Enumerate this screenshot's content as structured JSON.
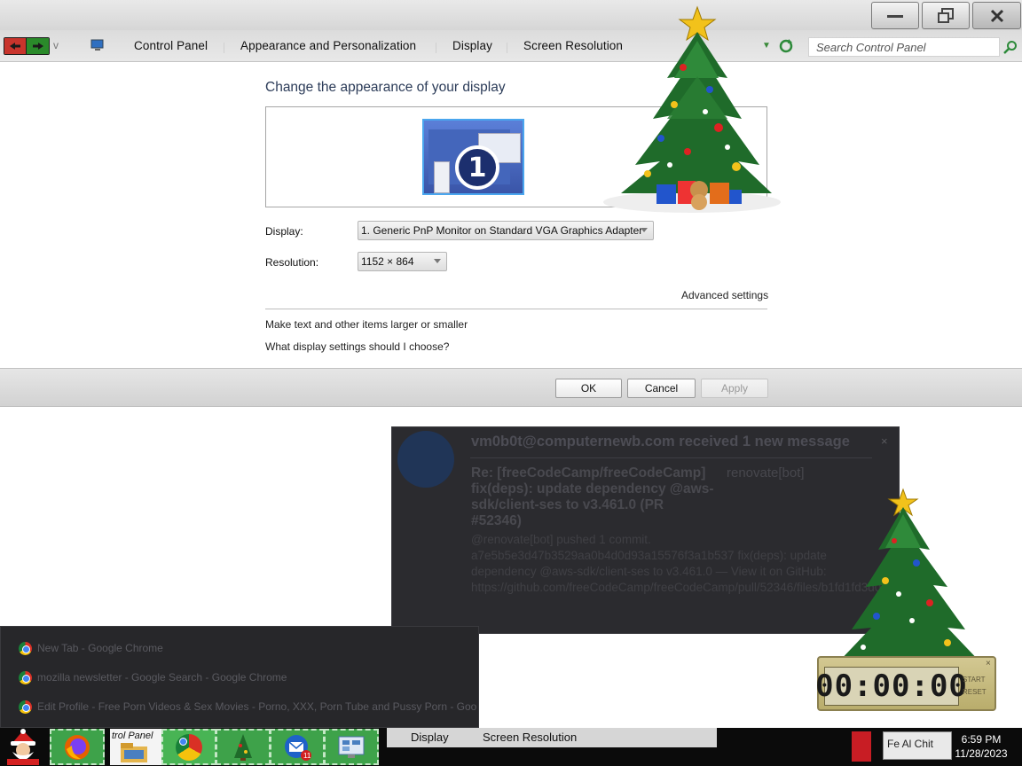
{
  "window": {
    "controls": {
      "minimize": "minimize",
      "maximize": "restore",
      "close": "close"
    }
  },
  "addressbar": {
    "breadcrumbs": [
      "Control Panel",
      "Appearance and Personalization",
      "Display",
      "Screen Resolution"
    ],
    "search_placeholder": "Search Control Panel"
  },
  "main": {
    "title": "Change the appearance of your display",
    "monitor_number": "1",
    "display_label": "Display:",
    "display_value": "1. Generic PnP Monitor on Standard VGA Graphics Adapter",
    "resolution_label": "Resolution:",
    "resolution_value": "1152 × 864",
    "advanced_link": "Advanced settings",
    "links": [
      "Make text and other items larger or smaller",
      "What display settings should I choose?"
    ]
  },
  "footer": {
    "ok": "OK",
    "cancel": "Cancel",
    "apply": "Apply"
  },
  "notification": {
    "title": "vm0b0t@computernewb.com received 1 new message",
    "close": "×",
    "subject": "Re: [freeCodeCamp/freeCodeCamp] fix(deps): update dependency @aws-sdk/client-ses to v3.461.0 (PR #52346)",
    "sender": "renovate[bot]",
    "body": "@renovate[bot] pushed 1 commit. a7e5b5e3d47b3529aa0b4d0d93a15576f3a1b537 fix(deps): update dependency @aws-sdk/client-ses to v3.461.0 — View it on GitHub: https://github.com/freeCodeCamp/freeCodeCamp/pull/52346/files/b1fd1fd3d0d8b87fe4e0454f78830"
  },
  "jumplist": {
    "items": [
      "New Tab - Google Chrome",
      "mozilla newsletter - Google Search - Google Chrome",
      "Edit Profile - Free Porn Videos & Sex Movies - Porno, XXX, Porn Tube and Pussy Porn - Goo"
    ]
  },
  "clock": {
    "time": "00:00:00",
    "start": "START",
    "reset": "RESET",
    "close": "×"
  },
  "taskbar": {
    "control_panel_label": "trol Panel",
    "strip_items": [
      "Display",
      "Screen Resolution"
    ],
    "tray_text": "Fe Al Chit",
    "time": "6:59 PM",
    "date": "11/28/2023",
    "badge": "11"
  },
  "icons": {
    "back": "back-arrow-icon",
    "forward": "forward-arrow-icon",
    "control_panel": "control-panel-icon",
    "refresh": "refresh-icon",
    "search": "search-icon",
    "chrome": "chrome-icon",
    "firefox": "firefox-icon",
    "explorer": "file-explorer-icon",
    "tree": "christmas-tree-icon",
    "thunderbird": "mail-client-icon",
    "app": "control-panel-app-icon",
    "santa": "santa-start-icon"
  },
  "colors": {
    "nav_back": "#c8342c",
    "nav_forward": "#2a8a2a",
    "taskbar_app": "#3ea24a",
    "notification_bg": "#2b2b2f",
    "title_text": "#2b3b58"
  }
}
